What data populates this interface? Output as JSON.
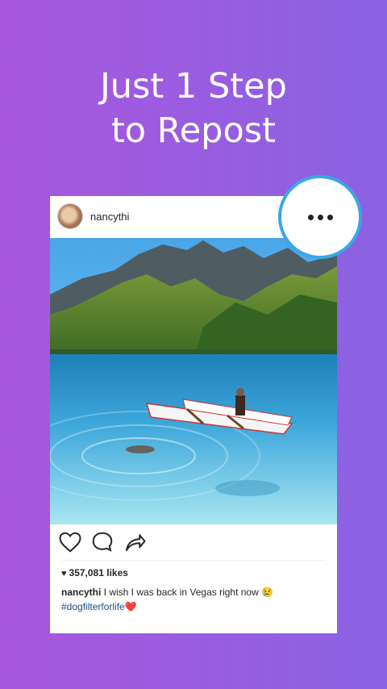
{
  "headline": {
    "line1": "Just 1 Step",
    "line2": "to Repost"
  },
  "post": {
    "username": "nancythi",
    "likes": "357,081 likes",
    "caption_user": "nancythi",
    "caption_text": " I wish I was back in Vegas right now 😢",
    "hashtag": "#dogfilterforlife",
    "hashtag_emoji": "❤️"
  },
  "icons": {
    "more": "more-options-icon",
    "like": "heart-icon",
    "comment": "comment-icon",
    "share": "share-icon"
  },
  "colors": {
    "background_start": "#a757dd",
    "background_end": "#8a63e2",
    "highlight_ring": "#3aa7e6",
    "hashtag": "#1b4c89"
  }
}
